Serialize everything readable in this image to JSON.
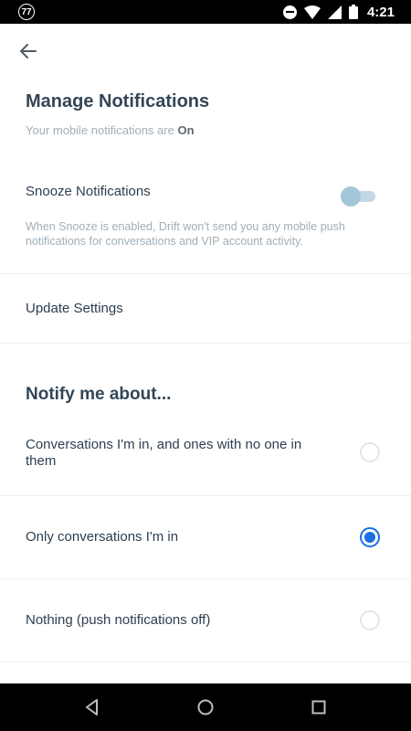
{
  "status_bar": {
    "notification_badge": "77",
    "time": "4:21",
    "icons": [
      "do-not-disturb-icon",
      "wifi-icon",
      "signal-icon",
      "battery-icon"
    ]
  },
  "header": {
    "back_icon": "arrow-left-icon",
    "title": "Manage Notifications",
    "subtitle_prefix": "Your mobile notifications are ",
    "subtitle_status": "On"
  },
  "snooze": {
    "label": "Snooze Notifications",
    "enabled": false,
    "description": "When Snooze is enabled, Drift won't send you any mobile push notifications for conversations and VIP account activity."
  },
  "update_settings": {
    "label": "Update Settings"
  },
  "notify": {
    "title": "Notify me about...",
    "options": [
      {
        "label": "Conversations I'm in, and ones with no one in them",
        "selected": false
      },
      {
        "label": "Only conversations I'm in",
        "selected": true
      },
      {
        "label": "Nothing (push notifications off)",
        "selected": false
      }
    ]
  },
  "colors": {
    "accent": "#1b6ee4",
    "toggle_off": "#a5c5d8",
    "muted_text": "#a0aeb9",
    "heading": "#334656"
  },
  "nav_bar": {
    "icons": [
      "back-triangle-icon",
      "home-circle-icon",
      "recents-square-icon"
    ]
  }
}
